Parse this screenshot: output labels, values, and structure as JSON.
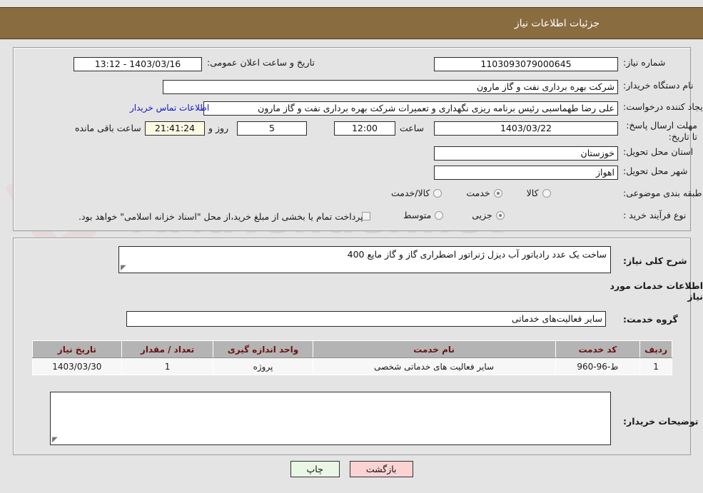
{
  "header": {
    "title": "جزئیات اطلاعات نیاز",
    "bar_color": "#8a6c41"
  },
  "watermark": {
    "text": "AriaTender.net"
  },
  "top_section": {
    "need_number": {
      "label": "شماره نیاز:",
      "value": "1103093079000645"
    },
    "public_announce": {
      "label": "تاریخ و ساعت اعلان عمومی:",
      "value": "1403/03/16 - 13:12"
    },
    "buyer_org": {
      "label": "نام دستگاه خریدار:",
      "value": "شرکت بهره برداری نفت و گاز مارون"
    },
    "requester": {
      "label": "ایجاد کننده درخواست:",
      "value": "علی رضا طهماسبی رئیس برنامه ریزی نگهداری و تعمیرات شرکت بهره برداری نفت و گاز مارون",
      "contact_link": "اطلاعات تماس خریدار"
    },
    "deadline": {
      "label": "مهلت ارسال پاسخ: تا تاریخ:",
      "date": "1403/03/22",
      "time_label": "ساعت",
      "time": "12:00",
      "days": "5",
      "days_label": "روز و",
      "countdown": "21:41:24",
      "countdown_label": "ساعت باقی مانده"
    },
    "province": {
      "label": "استان محل تحویل:",
      "value": "خوزستان"
    },
    "city": {
      "label": "شهر محل تحویل:",
      "value": "اهواز"
    },
    "category": {
      "label": "طبقه بندی موضوعی:",
      "options": [
        {
          "text": "کالا",
          "selected": false
        },
        {
          "text": "خدمت",
          "selected": true
        },
        {
          "text": "کالا/خدمت",
          "selected": false
        }
      ]
    },
    "process_type": {
      "label": "نوع فرآیند خرید :",
      "options": [
        {
          "text": "جزیی",
          "selected": true
        },
        {
          "text": "متوسط",
          "selected": false
        }
      ],
      "checkbox_note": "پرداخت تمام یا بخشی از مبلغ خرید،از محل \"اسناد خزانه اسلامی\" خواهد بود.",
      "checkbox_checked": false
    }
  },
  "bottom_section": {
    "general_desc": {
      "label": "شرح کلی نیاز:",
      "value": "ساخت یک عدد رادیاتور آب دیزل ژنراتور اضطراری گاز و گاز مایع 400"
    },
    "services_heading": "اطلاعات خدمات مورد نیاز",
    "service_group": {
      "label": "گروه خدمت:",
      "value": "سایر فعالیت‌های خدماتی"
    },
    "table": {
      "columns": [
        "ردیف",
        "کد خدمت",
        "نام خدمت",
        "واحد اندازه گیری",
        "تعداد / مقدار",
        "تاریخ نیاز"
      ],
      "rows": [
        [
          "1",
          "ط-96-960",
          "سایر فعالیت های خدماتی شخصی",
          "پروژه",
          "1",
          "1403/03/30"
        ]
      ]
    },
    "buyer_notes": {
      "label": "توضیحات خریدار:",
      "value": ""
    }
  },
  "buttons": {
    "back": "بازگشت",
    "print": "چاپ"
  }
}
